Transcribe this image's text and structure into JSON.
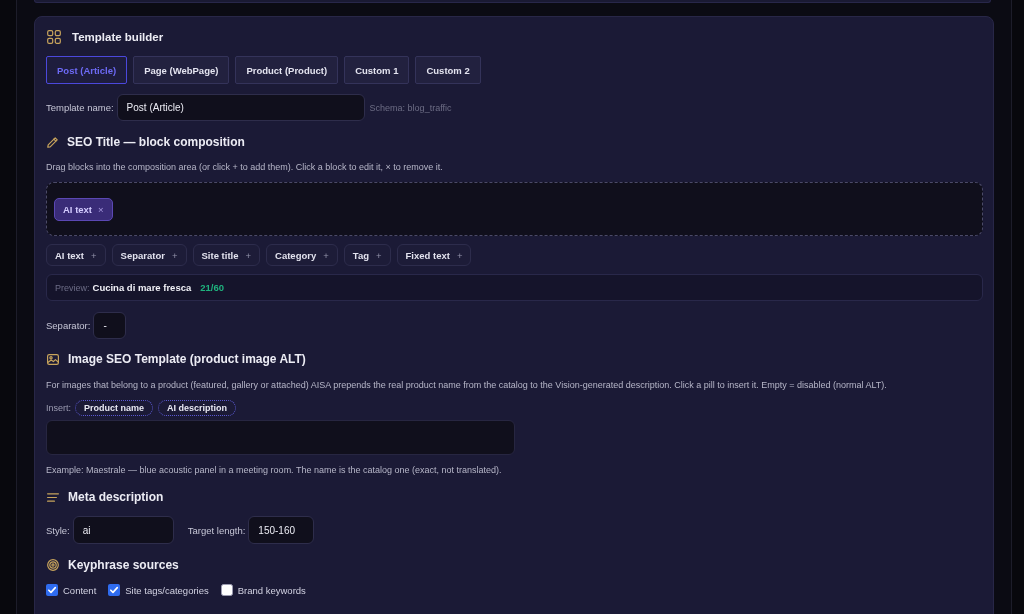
{
  "template_builder": {
    "title": "Template builder",
    "tabs": [
      {
        "label": "Post (Article)",
        "selected": true
      },
      {
        "label": "Page (WebPage)",
        "selected": false
      },
      {
        "label": "Product (Product)",
        "selected": false
      },
      {
        "label": "Custom 1",
        "selected": false
      },
      {
        "label": "Custom 2",
        "selected": false
      }
    ],
    "template_name": {
      "label": "Template name:",
      "value": "Post (Article)"
    },
    "schema": "Schema: blog_traffic"
  },
  "seo_title": {
    "title": "SEO Title — block composition",
    "hint": "Drag blocks into the composition area (or click + to add them). Click a block to edit it, × to remove it.",
    "composition": [
      {
        "label": "AI text",
        "remove": "×"
      }
    ],
    "blocks": [
      {
        "label": "AI text",
        "add": "+"
      },
      {
        "label": "Separator",
        "add": "+"
      },
      {
        "label": "Site title",
        "add": "+"
      },
      {
        "label": "Category",
        "add": "+"
      },
      {
        "label": "Tag",
        "add": "+"
      },
      {
        "label": "Fixed text",
        "add": "+"
      }
    ],
    "preview": {
      "label": "Preview:",
      "text": "Cucina di mare fresca",
      "count": "21/60"
    },
    "separator": {
      "label": "Separator:",
      "value": "-"
    }
  },
  "image_seo": {
    "title": "Image SEO Template (product image ALT)",
    "description": "For images that belong to a product (featured, gallery or attached) AISA prepends the real product name from the catalog to the Vision-generated description. Click a pill to insert it. Empty = disabled (normal ALT).",
    "insert_label": "Insert:",
    "pills": [
      "Product name",
      "AI description"
    ],
    "example": "Example: Maestrale — blue acoustic panel in a meeting room. The name is the catalog one (exact, not translated)."
  },
  "meta_description": {
    "title": "Meta description",
    "style": {
      "label": "Style:",
      "value": "ai"
    },
    "target_length": {
      "label": "Target length:",
      "value": "150-160"
    }
  },
  "keyphrase_sources": {
    "title": "Keyphrase sources",
    "options": [
      {
        "label": "Content",
        "checked": true
      },
      {
        "label": "Site tags/categories",
        "checked": true
      },
      {
        "label": "Brand keywords",
        "checked": false
      }
    ]
  }
}
